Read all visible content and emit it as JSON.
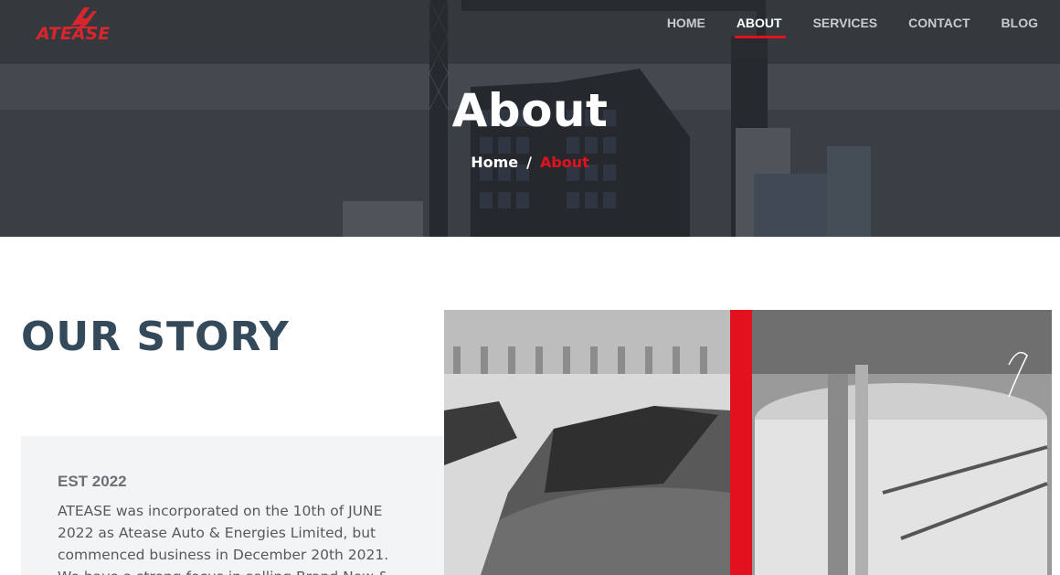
{
  "brand": {
    "logo_text": "ATEASE",
    "accent_color": "#e3101e"
  },
  "nav": {
    "items": [
      {
        "label": "HOME",
        "active": false
      },
      {
        "label": "ABOUT",
        "active": true
      },
      {
        "label": "SERVICES",
        "active": false
      },
      {
        "label": "CONTACT",
        "active": false
      },
      {
        "label": "BLOG",
        "active": false
      }
    ]
  },
  "hero": {
    "title": "About",
    "breadcrumb": {
      "home": "Home",
      "separator": "/",
      "current": "About"
    }
  },
  "story": {
    "heading": "OUR STORY",
    "est": "EST 2022",
    "text": "ATEASE was incorporated on the 10th of JUNE 2022 as Atease Auto & Energies Limited, but commenced business in December 20th 2021. We have a strong focus in selling Brand New &"
  },
  "colors": {
    "heading": "#34495a",
    "card_bg": "#f3f4f6",
    "divider_red": "#e3101e"
  }
}
